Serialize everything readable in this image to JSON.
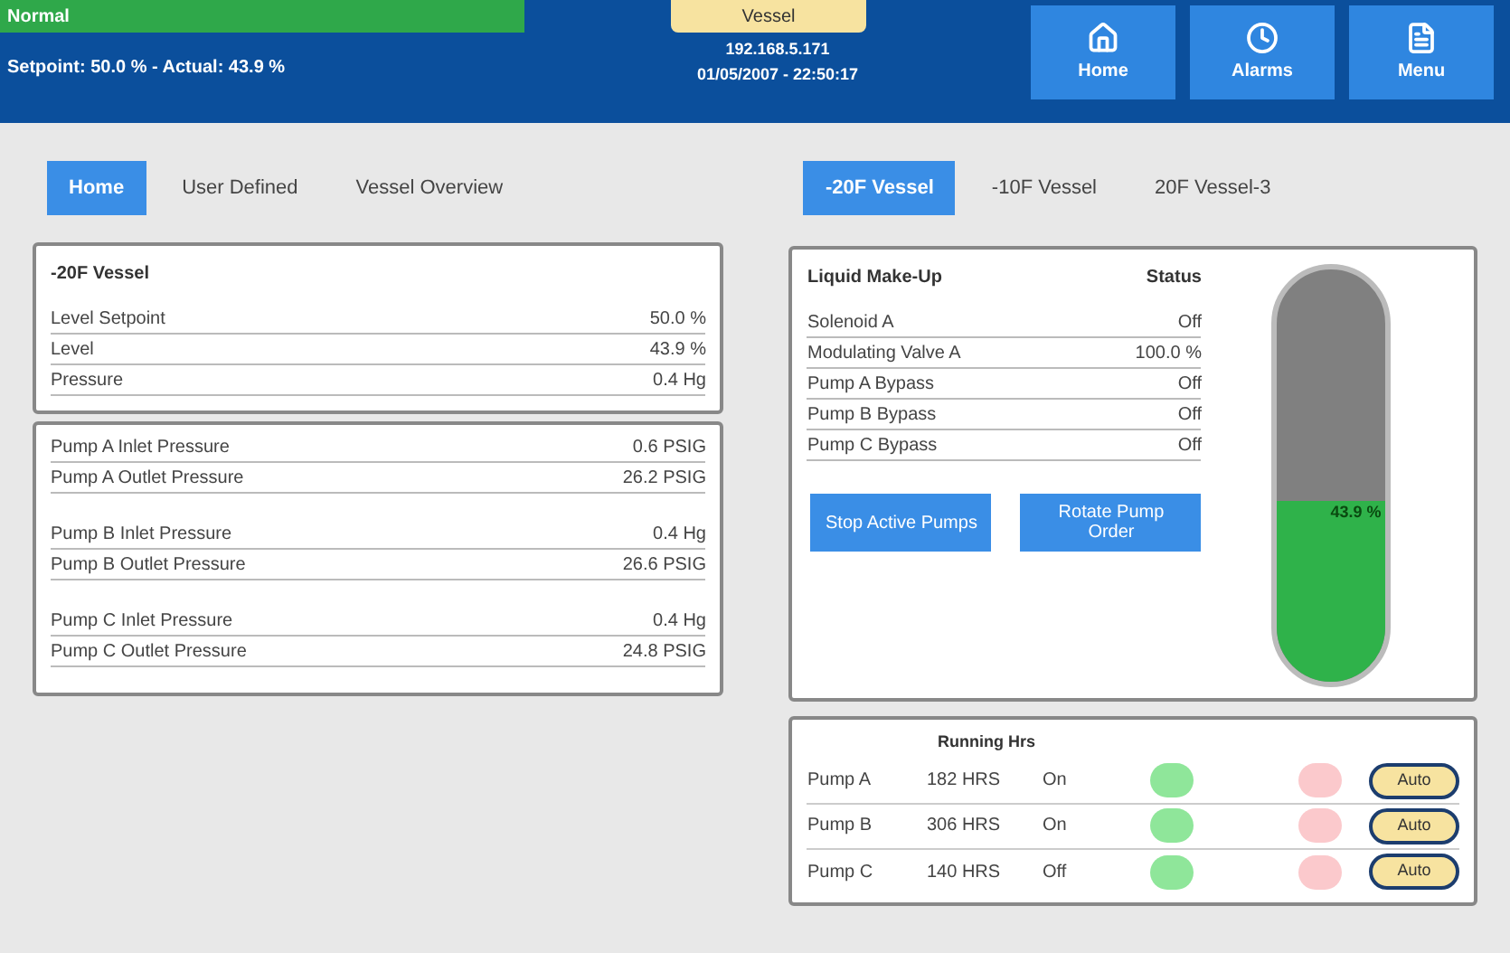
{
  "header": {
    "status": "Normal",
    "summary": "Setpoint: 50.0 % - Actual: 43.9 %",
    "title": "Vessel",
    "ip": "192.168.5.171",
    "datetime": "01/05/2007 - 22:50:17",
    "nav": [
      {
        "label": "Home"
      },
      {
        "label": "Alarms"
      },
      {
        "label": "Menu"
      }
    ]
  },
  "left_tabs": [
    {
      "label": "Home",
      "selected": true
    },
    {
      "label": "User Defined",
      "selected": false
    },
    {
      "label": "Vessel Overview",
      "selected": false
    }
  ],
  "right_tabs": [
    {
      "label": "-20F Vessel",
      "selected": true
    },
    {
      "label": "-10F Vessel",
      "selected": false
    },
    {
      "label": "20F Vessel-3",
      "selected": false
    }
  ],
  "vessel_panel": {
    "title": "-20F Vessel",
    "rows": [
      {
        "label": "Level Setpoint",
        "value": "50.0 %"
      },
      {
        "label": "Level",
        "value": "43.9 %"
      },
      {
        "label": "Pressure",
        "value": "0.4 Hg"
      }
    ]
  },
  "pressure_groups": [
    [
      {
        "label": "Pump A Inlet Pressure",
        "value": "0.6 PSIG"
      },
      {
        "label": "Pump A Outlet Pressure",
        "value": "26.2 PSIG"
      }
    ],
    [
      {
        "label": "Pump B Inlet Pressure",
        "value": "0.4 Hg"
      },
      {
        "label": "Pump B Outlet Pressure",
        "value": "26.6 PSIG"
      }
    ],
    [
      {
        "label": "Pump C Inlet Pressure",
        "value": "0.4 Hg"
      },
      {
        "label": "Pump C Outlet Pressure",
        "value": "24.8 PSIG"
      }
    ]
  ],
  "makeup": {
    "title": "Liquid Make-Up",
    "status_heading": "Status",
    "rows": [
      {
        "label": "Solenoid A",
        "value": "Off"
      },
      {
        "label": "Modulating Valve A",
        "value": "100.0 %"
      },
      {
        "label": "Pump A Bypass",
        "value": "Off"
      },
      {
        "label": "Pump B Bypass",
        "value": "Off"
      },
      {
        "label": "Pump C Bypass",
        "value": "Off"
      }
    ],
    "buttons": [
      "Stop Active Pumps",
      "Rotate Pump Order"
    ]
  },
  "tank": {
    "level": 0.439,
    "reading": "43.9 %"
  },
  "pumps": {
    "heading": "Running Hrs",
    "rows": [
      {
        "name": "Pump A",
        "hours": "182 HRS",
        "state": "On",
        "mode": "Auto"
      },
      {
        "name": "Pump B",
        "hours": "306 HRS",
        "state": "On",
        "mode": "Auto"
      },
      {
        "name": "Pump C",
        "hours": "140 HRS",
        "state": "Off",
        "mode": "Auto"
      }
    ]
  }
}
